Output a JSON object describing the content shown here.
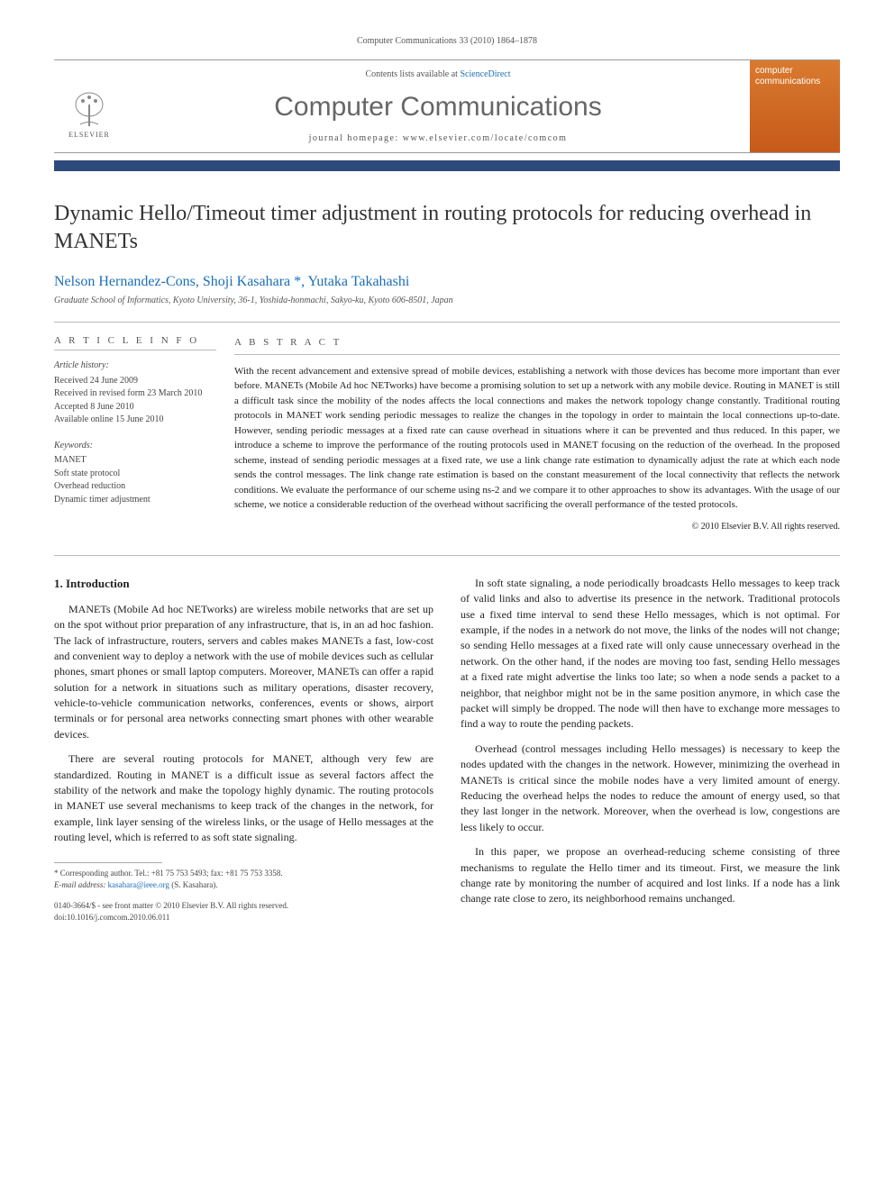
{
  "header": {
    "citation": "Computer Communications 33 (2010) 1864–1878"
  },
  "banner": {
    "contents_prefix": "Contents lists available at ",
    "contents_link": "ScienceDirect",
    "journal": "Computer Communications",
    "homepage_prefix": "journal homepage: ",
    "homepage": "www.elsevier.com/locate/comcom",
    "cover_label": "computer communications",
    "publisher_logo": "ELSEVIER"
  },
  "article": {
    "title": "Dynamic Hello/Timeout timer adjustment in routing protocols for reducing overhead in MANETs",
    "authors_text": "Nelson Hernandez-Cons, Shoji Kasahara *, Yutaka Takahashi",
    "affiliation": "Graduate School of Informatics, Kyoto University, 36-1, Yoshida-honmachi, Sakyo-ku, Kyoto 606-8501, Japan"
  },
  "info": {
    "section_label": "A R T I C L E   I N F O",
    "history_title": "Article history:",
    "history_lines": [
      "Received 24 June 2009",
      "Received in revised form 23 March 2010",
      "Accepted 8 June 2010",
      "Available online 15 June 2010"
    ],
    "keywords_title": "Keywords:",
    "keywords": [
      "MANET",
      "Soft state protocol",
      "Overhead reduction",
      "Dynamic timer adjustment"
    ]
  },
  "abstract": {
    "section_label": "A B S T R A C T",
    "text": "With the recent advancement and extensive spread of mobile devices, establishing a network with those devices has become more important than ever before. MANETs (Mobile Ad hoc NETworks) have become a promising solution to set up a network with any mobile device. Routing in MANET is still a difficult task since the mobility of the nodes affects the local connections and makes the network topology change constantly. Traditional routing protocols in MANET work sending periodic messages to realize the changes in the topology in order to maintain the local connections up-to-date. However, sending periodic messages at a fixed rate can cause overhead in situations where it can be prevented and thus reduced. In this paper, we introduce a scheme to improve the performance of the routing protocols used in MANET focusing on the reduction of the overhead. In the proposed scheme, instead of sending periodic messages at a fixed rate, we use a link change rate estimation to dynamically adjust the rate at which each node sends the control messages. The link change rate estimation is based on the constant measurement of the local connectivity that reflects the network conditions. We evaluate the performance of our scheme using ns-2 and we compare it to other approaches to show its advantages. With the usage of our scheme, we notice a considerable reduction of the overhead without sacrificing the overall performance of the tested protocols.",
    "copyright": "© 2010 Elsevier B.V. All rights reserved."
  },
  "body": {
    "section1_heading": "1. Introduction",
    "col1_p1": "MANETs (Mobile Ad hoc NETworks) are wireless mobile networks that are set up on the spot without prior preparation of any infrastructure, that is, in an ad hoc fashion. The lack of infrastructure, routers, servers and cables makes MANETs a fast, low-cost and convenient way to deploy a network with the use of mobile devices such as cellular phones, smart phones or small laptop computers. Moreover, MANETs can offer a rapid solution for a network in situations such as military operations, disaster recovery, vehicle-to-vehicle communication networks, conferences, events or shows, airport terminals or for personal area networks connecting smart phones with other wearable devices.",
    "col1_p2": "There are several routing protocols for MANET, although very few are standardized. Routing in MANET is a difficult issue as several factors affect the stability of the network and make the topology highly dynamic. The routing protocols in MANET use several mechanisms to keep track of the changes in the network, for example, link layer sensing of the wireless links, or the usage of Hello messages at the routing level, which is referred to as soft state signaling.",
    "col2_p1": "In soft state signaling, a node periodically broadcasts Hello messages to keep track of valid links and also to advertise its presence in the network. Traditional protocols use a fixed time interval to send these Hello messages, which is not optimal. For example, if the nodes in a network do not move, the links of the nodes will not change; so sending Hello messages at a fixed rate will only cause unnecessary overhead in the network. On the other hand, if the nodes are moving too fast, sending Hello messages at a fixed rate might advertise the links too late; so when a node sends a packet to a neighbor, that neighbor might not be in the same position anymore, in which case the packet will simply be dropped. The node will then have to exchange more messages to find a way to route the pending packets.",
    "col2_p2": "Overhead (control messages including Hello messages) is necessary to keep the nodes updated with the changes in the network. However, minimizing the overhead in MANETs is critical since the mobile nodes have a very limited amount of energy. Reducing the overhead helps the nodes to reduce the amount of energy used, so that they last longer in the network. Moreover, when the overhead is low, congestions are less likely to occur.",
    "col2_p3": "In this paper, we propose an overhead-reducing scheme consisting of three mechanisms to regulate the Hello timer and its timeout. First, we measure the link change rate by monitoring the number of acquired and lost links. If a node has a link change rate close to zero, its neighborhood remains unchanged."
  },
  "footnote": {
    "corresponding": "* Corresponding author. Tel.: +81 75 753 5493; fax: +81 75 753 3358.",
    "email_label": "E-mail address: ",
    "email": "kasahara@ieee.org",
    "email_suffix": " (S. Kasahara)."
  },
  "doi": {
    "line1": "0140-3664/$ - see front matter © 2010 Elsevier B.V. All rights reserved.",
    "line2": "doi:10.1016/j.comcom.2010.06.011"
  }
}
